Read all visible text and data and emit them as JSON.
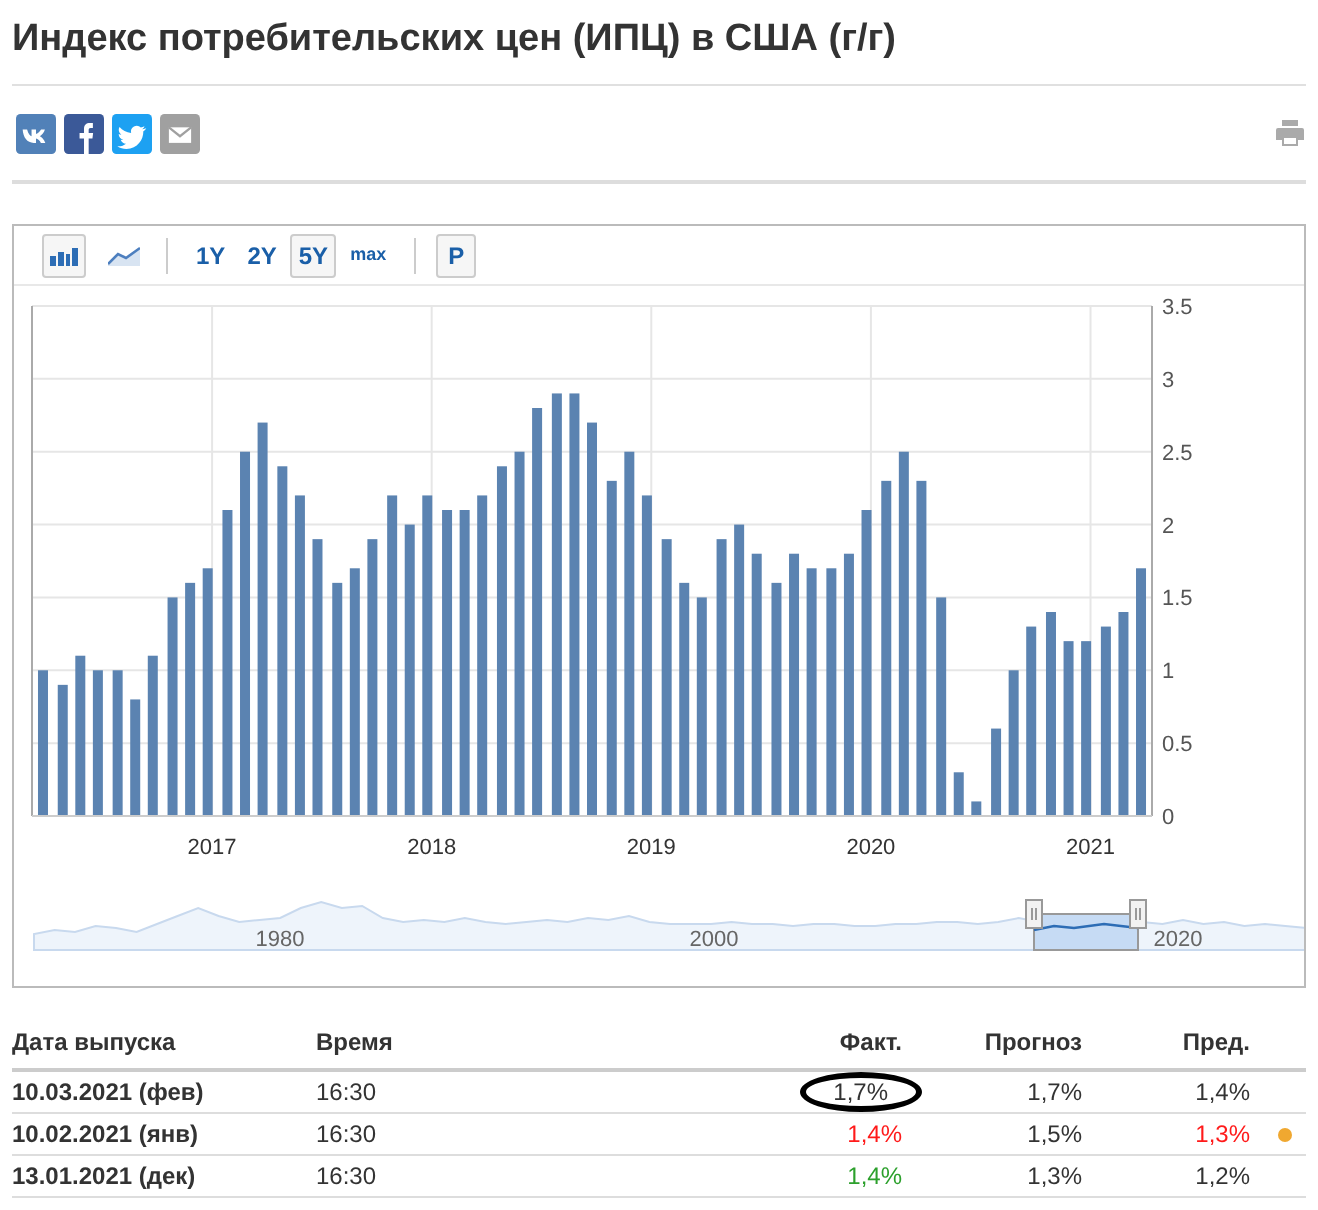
{
  "title": "Индекс потребительских цен (ИПЦ) в США (г/г)",
  "share_buttons": [
    {
      "kind": "vk",
      "color": "#5181b8"
    },
    {
      "kind": "facebook",
      "color": "#3b5998"
    },
    {
      "kind": "twitter",
      "color": "#1da1f2"
    },
    {
      "kind": "mail",
      "color": "#a0a0a0"
    }
  ],
  "toolbar": {
    "chart_type_buttons": [
      {
        "kind": "bar",
        "selected": true
      },
      {
        "kind": "line",
        "selected": false
      }
    ],
    "range_buttons": [
      {
        "label": "1Y",
        "selected": false
      },
      {
        "label": "2Y",
        "selected": false
      },
      {
        "label": "5Y",
        "selected": true
      },
      {
        "label": "max",
        "selected": false
      }
    ],
    "extra_button": {
      "label": "P"
    }
  },
  "chart_data": {
    "type": "bar",
    "x": [
      2016.23,
      2016.32,
      2016.4,
      2016.48,
      2016.57,
      2016.65,
      2016.73,
      2016.82,
      2016.9,
      2016.98,
      2017.07,
      2017.15,
      2017.23,
      2017.32,
      2017.4,
      2017.48,
      2017.57,
      2017.65,
      2017.73,
      2017.82,
      2017.9,
      2017.98,
      2018.07,
      2018.15,
      2018.23,
      2018.32,
      2018.4,
      2018.48,
      2018.57,
      2018.65,
      2018.73,
      2018.82,
      2018.9,
      2018.98,
      2019.07,
      2019.15,
      2019.23,
      2019.32,
      2019.4,
      2019.48,
      2019.57,
      2019.65,
      2019.73,
      2019.82,
      2019.9,
      2019.98,
      2020.07,
      2020.15,
      2020.23,
      2020.32,
      2020.4,
      2020.48,
      2020.57,
      2020.65,
      2020.73,
      2020.82,
      2020.9,
      2020.98,
      2021.07,
      2021.15,
      2021.23
    ],
    "series": [
      {
        "color": "#5b83b1",
        "values": [
          1.0,
          0.9,
          1.1,
          1.0,
          1.0,
          0.8,
          1.1,
          1.5,
          1.6,
          1.7,
          2.1,
          2.5,
          2.7,
          2.4,
          2.2,
          1.9,
          1.6,
          1.7,
          1.9,
          2.2,
          2.0,
          2.2,
          2.1,
          2.1,
          2.2,
          2.4,
          2.5,
          2.8,
          2.9,
          2.9,
          2.7,
          2.3,
          2.5,
          2.2,
          1.9,
          1.6,
          1.5,
          1.9,
          2.0,
          1.8,
          1.6,
          1.8,
          1.7,
          1.7,
          1.8,
          2.1,
          2.3,
          2.5,
          2.3,
          1.5,
          0.3,
          0.1,
          0.6,
          1.0,
          1.3,
          1.4,
          1.2,
          1.2,
          1.3,
          1.4,
          1.7
        ]
      }
    ],
    "xlim": [
      2016.18,
      2021.28
    ],
    "ylim": [
      0,
      3.5
    ],
    "grid": true,
    "yticks": [
      0,
      {
        "value": 0.5,
        "label": "0.5"
      },
      1,
      {
        "value": 1.5,
        "label": "1.5"
      },
      2,
      {
        "value": 2.5,
        "label": "2.5"
      },
      3,
      {
        "value": 3.5,
        "label": "3.5"
      }
    ],
    "xticks": [
      2017,
      2018,
      2019,
      2020,
      2021
    ]
  },
  "navigator": {
    "labels": [
      "1980",
      "2000",
      "2020"
    ]
  },
  "table": {
    "columns": [
      "Дата выпуска",
      "Время",
      "Факт.",
      "Прогноз",
      "Пред."
    ],
    "rows": [
      {
        "date": "10.03.2021 (фев)",
        "time": "16:30",
        "actual": {
          "text": "1,7%",
          "color": "#333333"
        },
        "circled": true,
        "forecast": "1,7%",
        "previous": {
          "text": "1,4%",
          "color": "#333333"
        },
        "revised": false
      },
      {
        "date": "10.02.2021 (янв)",
        "time": "16:30",
        "actual": {
          "text": "1,4%",
          "color": "#ff1a1a"
        },
        "circled": false,
        "forecast": "1,5%",
        "previous": {
          "text": "1,3%",
          "color": "#ff1a1a"
        },
        "revised": true
      },
      {
        "date": "13.01.2021 (дек)",
        "time": "16:30",
        "actual": {
          "text": "1,4%",
          "color": "#2ca02c"
        },
        "circled": false,
        "forecast": "1,3%",
        "previous": {
          "text": "1,2%",
          "color": "#333333"
        },
        "revised": false
      }
    ]
  }
}
